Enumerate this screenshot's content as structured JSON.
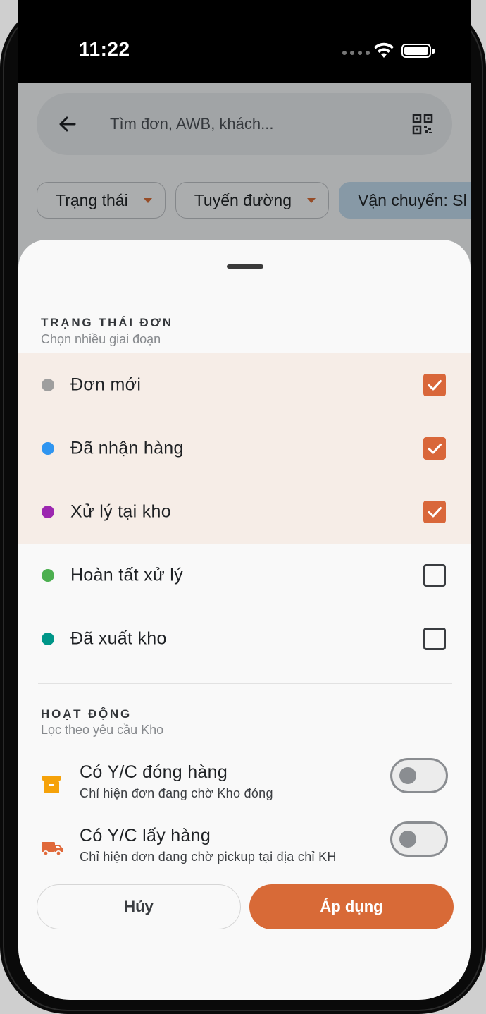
{
  "status_bar": {
    "time": "11:22"
  },
  "search": {
    "placeholder": "Tìm đơn, AWB, khách..."
  },
  "filter_chips": [
    {
      "label": "Trạng thái",
      "has_caret": true,
      "active": false
    },
    {
      "label": "Tuyến đường",
      "has_caret": true,
      "active": false
    },
    {
      "label": "Vận chuyển: Sl",
      "has_caret": false,
      "active": true
    }
  ],
  "status_section": {
    "title": "TRẠNG THÁI ĐƠN",
    "subtitle": "Chọn nhiều giai đoạn",
    "items": [
      {
        "label": "Đơn mới",
        "color": "#9e9e9e",
        "checked": true
      },
      {
        "label": "Đã nhận hàng",
        "color": "#2f95f0",
        "checked": true
      },
      {
        "label": "Xử lý tại kho",
        "color": "#9c27b0",
        "checked": true
      },
      {
        "label": "Hoàn tất xử lý",
        "color": "#4caf50",
        "checked": false
      },
      {
        "label": "Đã xuất kho",
        "color": "#009688",
        "checked": false
      }
    ]
  },
  "activity_section": {
    "title": "HOẠT ĐỘNG",
    "subtitle": "Lọc theo yêu cầu Kho",
    "items": [
      {
        "title": "Có Y/C đóng hàng",
        "subtitle": "Chỉ hiện đơn đang chờ Kho đóng",
        "icon": "package-icon",
        "icon_color": "#f5a20a",
        "enabled": false
      },
      {
        "title": "Có Y/C lấy hàng",
        "subtitle": "Chỉ hiện đơn đang chờ pickup tại địa chỉ KH",
        "icon": "truck-icon",
        "icon_color": "#e0693a",
        "enabled": false
      }
    ]
  },
  "actions": {
    "cancel_label": "Hủy",
    "apply_label": "Áp dụng"
  },
  "colors": {
    "accent": "#d86a37",
    "selected_row": "#f6ede7"
  }
}
